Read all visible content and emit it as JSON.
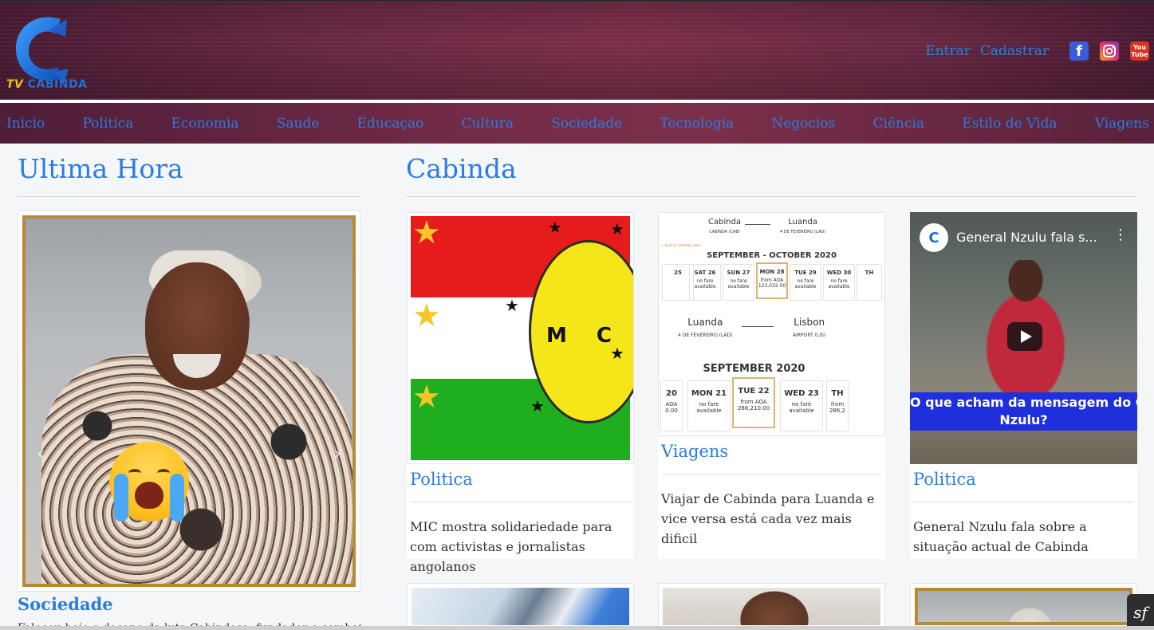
{
  "header": {
    "logo_text_tv": "TV",
    "logo_text_name": "CABINDA",
    "links": {
      "login": "Entrar",
      "register": "Cadastrar"
    },
    "youtube_label_top": "You",
    "youtube_label_bottom": "Tube",
    "facebook_glyph": "f"
  },
  "nav": {
    "items": [
      "Inicio",
      "Politica",
      "Economia",
      "Saude",
      "Educaçao",
      "Cultura",
      "Sociedade",
      "Tecnologia",
      "Negocios",
      "Ciência",
      "Estilo de Vida",
      "Viagens"
    ]
  },
  "left": {
    "title": "Ultima Hora",
    "hero": {
      "category": "Sociedade",
      "excerpt": "Faleceu hoje o decano da luta Cabindesa, fundador e combatente da causa"
    }
  },
  "right": {
    "title": "Cabinda",
    "cards": [
      {
        "category": "Politica",
        "text": "MIC mostra solidariedade para com activistas e jornalistas angolanos",
        "image_letters": "M  C"
      },
      {
        "category": "Viagens",
        "text": "Viajar de Cabinda para Luanda e vice versa está cada vez mais dificil",
        "flights": {
          "route1_from": "Cabinda",
          "route1_from_sub": "CABINDA (CAB)",
          "route1_to": "Luanda",
          "route1_to_sub": "4 DE FEVEREIRO (LAD)",
          "back_link": "← back to calendar view",
          "month1": "SEPTEMBER - OCTOBER 2020",
          "days1": [
            {
              "d": "25",
              "t": ""
            },
            {
              "d": "SAT 26",
              "t": "no fare available"
            },
            {
              "d": "SUN 27",
              "t": "no fare available"
            },
            {
              "d": "MON 28",
              "t": "from AOA 123,032.00"
            },
            {
              "d": "TUE 29",
              "t": "no fare available"
            },
            {
              "d": "WED 30",
              "t": "no fare available"
            },
            {
              "d": "TH",
              "t": ""
            }
          ],
          "route2_from": "Luanda",
          "route2_from_sub": "4 DE FEVEREIRO (LAD)",
          "route2_to": "Lisbon",
          "route2_to_sub": "AIRPORT (LIS)",
          "month2": "SEPTEMBER 2020",
          "days2": [
            {
              "d": "20",
              "t": "AOA 0.00"
            },
            {
              "d": "MON 21",
              "t": "no fare available"
            },
            {
              "d": "TUE 22",
              "t": "from AOA 286,210.00"
            },
            {
              "d": "WED 23",
              "t": "no fare available"
            },
            {
              "d": "TH",
              "t": "from 286,2"
            }
          ]
        }
      },
      {
        "category": "Politica",
        "text": "General Nzulu fala sobre a situação actual de Cabinda",
        "video": {
          "title": "General Nzulu fala s...",
          "caption_line1": "O que acham da mensagem do Ge",
          "caption_line2": "Nzulu?",
          "logo_letter": "C"
        }
      }
    ]
  },
  "fab_glyph": "sf"
}
